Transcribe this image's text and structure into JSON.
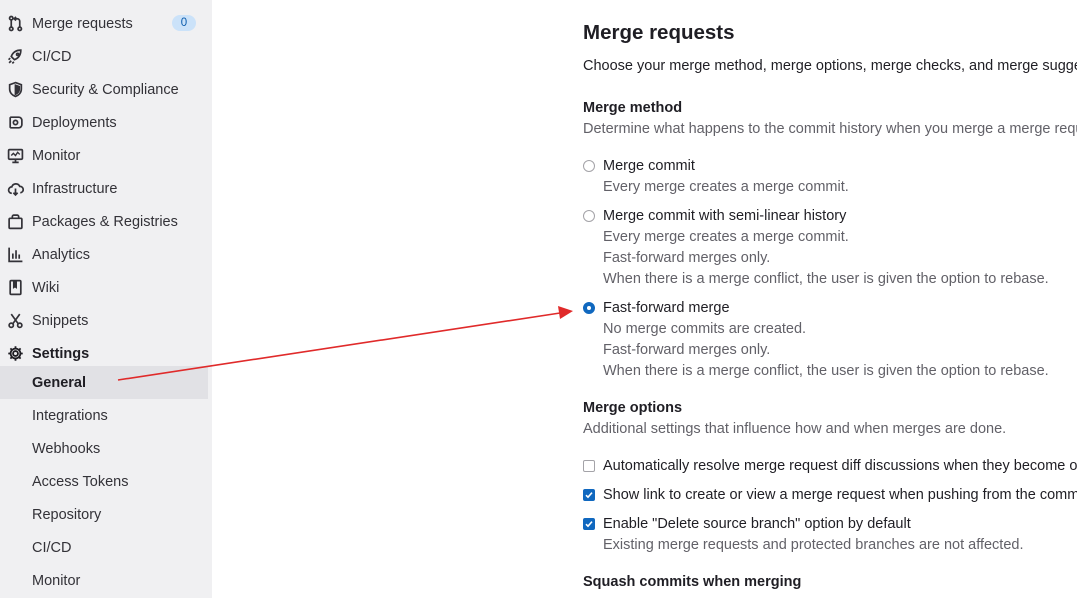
{
  "sidebar": {
    "items": [
      {
        "label": "Merge requests",
        "icon": "merge-request-icon",
        "badge": "0"
      },
      {
        "label": "CI/CD",
        "icon": "rocket-icon"
      },
      {
        "label": "Security & Compliance",
        "icon": "shield-icon"
      },
      {
        "label": "Deployments",
        "icon": "deployments-icon"
      },
      {
        "label": "Monitor",
        "icon": "monitor-icon"
      },
      {
        "label": "Infrastructure",
        "icon": "cloud-icon"
      },
      {
        "label": "Packages & Registries",
        "icon": "package-icon"
      },
      {
        "label": "Analytics",
        "icon": "chart-icon"
      },
      {
        "label": "Wiki",
        "icon": "book-icon"
      },
      {
        "label": "Snippets",
        "icon": "scissors-icon"
      },
      {
        "label": "Settings",
        "icon": "gear-icon"
      }
    ],
    "sub_items": [
      {
        "label": "General",
        "active": true
      },
      {
        "label": "Integrations"
      },
      {
        "label": "Webhooks"
      },
      {
        "label": "Access Tokens"
      },
      {
        "label": "Repository"
      },
      {
        "label": "CI/CD"
      },
      {
        "label": "Monitor"
      }
    ]
  },
  "main": {
    "title": "Merge requests",
    "intro": "Choose your merge method, merge options, merge checks, and merge suggestions.",
    "merge_method": {
      "heading": "Merge method",
      "description": "Determine what happens to the commit history when you merge a merge request.",
      "options": [
        {
          "label": "Merge commit",
          "selected": false,
          "help": [
            "Every merge creates a merge commit."
          ]
        },
        {
          "label": "Merge commit with semi-linear history",
          "selected": false,
          "help": [
            "Every merge creates a merge commit.",
            "Fast-forward merges only.",
            "When there is a merge conflict, the user is given the option to rebase."
          ]
        },
        {
          "label": "Fast-forward merge",
          "selected": true,
          "help": [
            "No merge commits are created.",
            "Fast-forward merges only.",
            "When there is a merge conflict, the user is given the option to rebase."
          ]
        }
      ]
    },
    "merge_options": {
      "heading": "Merge options",
      "description": "Additional settings that influence how and when merges are done.",
      "checkboxes": [
        {
          "label": "Automatically resolve merge request diff discussions when they become outdated",
          "checked": false
        },
        {
          "label": "Show link to create or view a merge request when pushing from the command line",
          "checked": true
        },
        {
          "label": "Enable \"Delete source branch\" option by default",
          "checked": true,
          "help": "Existing merge requests and protected branches are not affected."
        }
      ]
    },
    "squash": {
      "heading": "Squash commits when merging"
    }
  },
  "colors": {
    "accent": "#1068bf",
    "annotation_arrow": "#e02a2a",
    "sidebar_bg": "#f0f0f2",
    "active_bg": "#e1e1e5"
  }
}
